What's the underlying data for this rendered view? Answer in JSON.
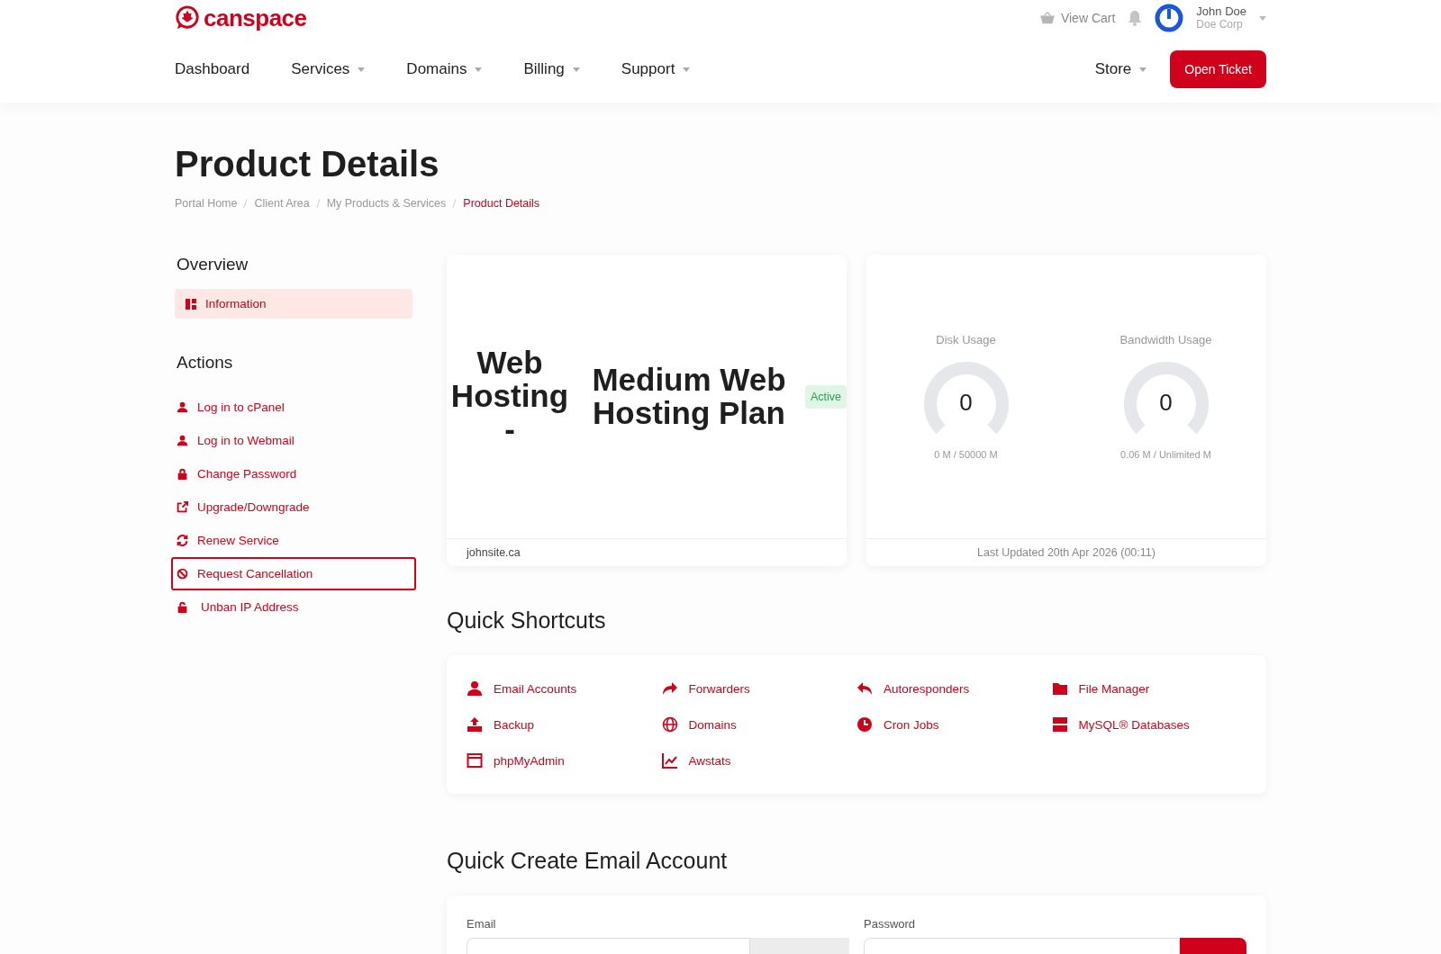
{
  "header": {
    "logo": "canspace",
    "cart": "View Cart",
    "user": {
      "name": "John Doe",
      "company": "Doe Corp"
    },
    "nav": [
      {
        "label": "Dashboard",
        "dropdown": false
      },
      {
        "label": "Services",
        "dropdown": true
      },
      {
        "label": "Domains",
        "dropdown": true
      },
      {
        "label": "Billing",
        "dropdown": true
      },
      {
        "label": "Support",
        "dropdown": true
      }
    ],
    "store": {
      "label": "Store",
      "dropdown": true
    },
    "cta": "Open Ticket"
  },
  "page": {
    "title": "Product Details",
    "breadcrumb": [
      {
        "label": "Portal Home",
        "selected": false
      },
      {
        "label": "Client Area",
        "selected": false
      },
      {
        "label": "My Products & Services",
        "selected": false
      },
      {
        "label": "Product Details",
        "selected": true
      }
    ]
  },
  "sidebar": {
    "overview": {
      "title": "Overview",
      "items": [
        {
          "label": "Information",
          "kind": "dashboard",
          "selected": true
        }
      ]
    },
    "actions": {
      "title": "Actions",
      "items": [
        {
          "label": "Log in to cPanel",
          "kind": "user",
          "highlighted": false
        },
        {
          "label": "Log in to Webmail",
          "kind": "user",
          "highlighted": false
        },
        {
          "label": "Change Password",
          "kind": "lock",
          "highlighted": false
        },
        {
          "label": "Upgrade/Downgrade",
          "kind": "external",
          "highlighted": false
        },
        {
          "label": "Renew Service",
          "kind": "sync",
          "highlighted": false
        },
        {
          "label": "Request Cancellation",
          "kind": "ban",
          "highlighted": true
        },
        {
          "label": "Unban IP Address",
          "kind": "unlock",
          "highlighted": false
        }
      ]
    }
  },
  "product": {
    "group": "Web Hosting -",
    "name": "Medium Web Hosting Plan",
    "status": "Active",
    "domain": "johnsite.ca"
  },
  "usage": {
    "gauges": [
      {
        "label": "Disk Usage",
        "value": "0",
        "reading": "0 M / 50000 M"
      },
      {
        "label": "Bandwidth Usage",
        "value": "0",
        "reading": "0.06 M / Unlimited M"
      }
    ],
    "updated": "Last Updated 20th Apr 2026 (00:11)"
  },
  "shortcuts": {
    "title": "Quick Shortcuts",
    "items": [
      {
        "label": "Email Accounts",
        "kind": "user"
      },
      {
        "label": "Forwarders",
        "kind": "forward"
      },
      {
        "label": "Autoresponders",
        "kind": "reply"
      },
      {
        "label": "File Manager",
        "kind": "folder"
      },
      {
        "label": "Backup",
        "kind": "upload"
      },
      {
        "label": "Domains",
        "kind": "globe"
      },
      {
        "label": "Cron Jobs",
        "kind": "clock"
      },
      {
        "label": "MySQL® Databases",
        "kind": "server"
      },
      {
        "label": "phpMyAdmin",
        "kind": "window"
      },
      {
        "label": "Awstats",
        "kind": "chart"
      }
    ]
  },
  "quick_create": {
    "title": "Quick Create Email Account",
    "fields": [
      {
        "label": "Email"
      },
      {
        "label": "Password"
      }
    ]
  }
}
